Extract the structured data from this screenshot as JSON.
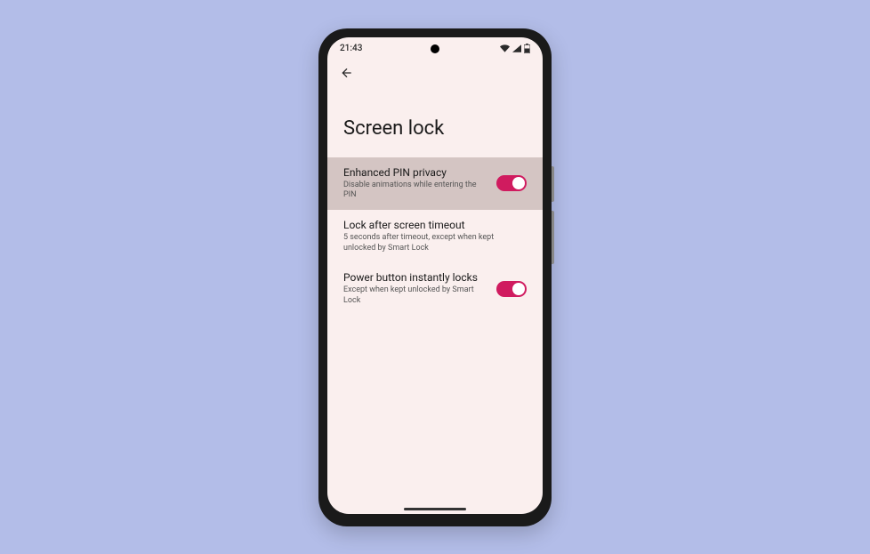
{
  "status_bar": {
    "time": "21:43"
  },
  "page": {
    "title": "Screen lock"
  },
  "settings": [
    {
      "title": "Enhanced PIN privacy",
      "subtitle": "Disable animations while entering the PIN",
      "toggle": true
    },
    {
      "title": "Lock after screen timeout",
      "subtitle": "5 seconds after timeout, except when kept unlocked by Smart Lock",
      "toggle": false
    },
    {
      "title": "Power button instantly locks",
      "subtitle": "Except when kept unlocked by Smart Lock",
      "toggle": true
    }
  ]
}
